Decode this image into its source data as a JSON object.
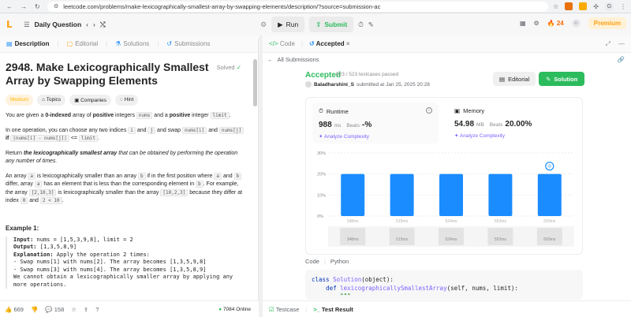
{
  "browser": {
    "url": "leetcode.com/problems/make-lexicographically-smallest-array-by-swapping-elements/description/?source=submission-ac",
    "profile_initial": "G"
  },
  "topbar": {
    "daily_label": "Daily Question",
    "run_label": "Run",
    "submit_label": "Submit",
    "streak": "24",
    "premium_label": "Premium"
  },
  "left": {
    "tabs": [
      "Description",
      "Editorial",
      "Solutions",
      "Submissions"
    ],
    "title": "2948. Make Lexicographically Smallest Array by Swapping Elements",
    "solved": "Solved",
    "badges": [
      "Medium",
      "Topics",
      "Companies",
      "Hint"
    ],
    "p1_a": "You are given a ",
    "p1_b": "0-indexed",
    "p1_c": " array of ",
    "p1_d": "positive",
    "p1_e": " integers ",
    "p1_f": "nums",
    "p1_g": " and a ",
    "p1_h": "positive",
    "p1_i": " integer ",
    "p1_j": "limit",
    "p1_k": ".",
    "p2_a": "In one operation, you can choose any two indices ",
    "p2_b": "i",
    "p2_c": " and ",
    "p2_d": "j",
    "p2_e": " and swap ",
    "p2_f": "nums[i]",
    "p2_g": " and ",
    "p2_h": "nums[j]",
    "p2_i": " if ",
    "p2_j": "|nums[i] - nums[j]|",
    "p2_k": " <= ",
    "p2_l": "limit",
    "p2_m": ".",
    "p3_a": "Return ",
    "p3_b": "the lexicographically smallest array",
    "p3_c": " that can be obtained by performing the operation any number of times.",
    "p4_a": "An array ",
    "p4_b": "a",
    "p4_c": " is lexicographically smaller than an array ",
    "p4_d": "b",
    "p4_e": " if in the first position where ",
    "p4_f": "a",
    "p4_g": " and ",
    "p4_h": "b",
    "p4_i": " differ, array ",
    "p4_j": "a",
    "p4_k": " has an element that is less than the corresponding element in ",
    "p4_l": "b",
    "p4_m": ". For example, the array ",
    "p4_n": "[2,10,3]",
    "p4_o": " is lexicographically smaller than the array ",
    "p4_p": "[10,2,3]",
    "p4_q": " because they differ at index ",
    "p4_r": "0",
    "p4_s": " and ",
    "p4_t": "2 < 10",
    "p4_u": ".",
    "example_title": "Example 1:",
    "example_lines": [
      {
        "k": "Input:",
        "v": " nums = [1,5,3,9,8], limit = 2"
      },
      {
        "k": "Output:",
        "v": " [1,3,5,8,9]"
      },
      {
        "k": "Explanation:",
        "v": " Apply the operation 2 times:"
      },
      {
        "k": "",
        "v": "- Swap nums[1] with nums[2]. The array becomes [1,3,5,9,8]"
      },
      {
        "k": "",
        "v": "- Swap nums[3] with nums[4]. The array becomes [1,3,5,8,9]"
      },
      {
        "k": "",
        "v": "We cannot obtain a lexicographically smaller array by applying any"
      },
      {
        "k": "",
        "v": "more operations."
      }
    ],
    "likes": "669",
    "comments": "158",
    "online": "7084 Online"
  },
  "right": {
    "tabs": [
      "Code",
      "Accepted"
    ],
    "all_submissions": "All Submissions",
    "status": "Accepted",
    "passed": "523 / 523 testcases passed",
    "user": "Baladharshini_S",
    "submitted": "submitted at Jan 25, 2025 20:28",
    "editorial_label": "Editorial",
    "solution_label": "Solution",
    "runtime_label": "Runtime",
    "runtime_value": "988",
    "runtime_unit": "ms",
    "runtime_beats_label": "Beats",
    "runtime_beats": "-%",
    "memory_label": "Memory",
    "memory_value": "54.98",
    "memory_unit": "MB",
    "memory_beats_label": "Beats",
    "memory_beats": "20.00%",
    "analyze_label": "Analyze Complexity",
    "code_tabs": [
      "Code",
      "Python"
    ],
    "code_lines": [
      "class Solution(object):",
      "    def lexicographicallySmallestArray(self, nums, limit):",
      "        \"\"\""
    ],
    "bottom_tabs": [
      "Testcase",
      "Test Result"
    ]
  },
  "chart_data": {
    "type": "bar",
    "categories": [
      "348ms",
      "515ms",
      "524ms",
      "553ms",
      "600ms"
    ],
    "values": [
      20,
      20,
      20,
      20,
      20
    ],
    "yticks": [
      "30%",
      "20%",
      "10%",
      "0%"
    ],
    "ylim": [
      0,
      30
    ],
    "bar_color": "#1a8cff",
    "range_labels": [
      "348ms",
      "515ms",
      "524ms",
      "553ms",
      "600ms"
    ]
  }
}
